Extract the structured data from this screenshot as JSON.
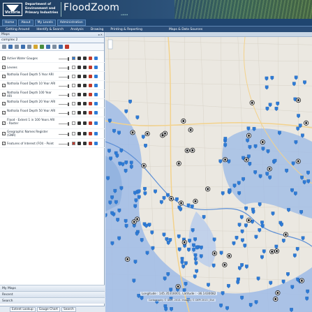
{
  "header": {
    "logo_text": "Victoria",
    "department": "Department of Environment and Primary Industries",
    "app_title": "FloodZoom",
    "version": "v.4.0.0"
  },
  "nav_links": [
    "Home",
    "About",
    "My Levels",
    "Administration"
  ],
  "menu": [
    "Getting Around",
    "Identify & Search",
    "Analysis",
    "Drawing",
    "Printing & Reporting",
    "Maps & Data Sources"
  ],
  "panel": {
    "title": "Maps",
    "subtitle": "complex 2",
    "layers": [
      {
        "label": "Active Water Gauges",
        "checked": true
      },
      {
        "label": "Levees",
        "checked": true
      },
      {
        "label": "Nathalia Flood Depth 5 Year ARI",
        "checked": true
      },
      {
        "label": "Nathalia Flood Depth 10 Year ARI",
        "checked": true
      },
      {
        "label": "Nathalia Flood Depth 100 Year ARI",
        "checked": true
      },
      {
        "label": "Nathalia Flood Depth 20 Year ARI",
        "checked": true
      },
      {
        "label": "Nathalia Flood Depth 50 Year ARI",
        "checked": true
      },
      {
        "label": "Flood - Extent 1 in 100 Years ARI - Raster",
        "checked": true
      },
      {
        "label": "Geographic Names Register (GNR)",
        "checked": true
      },
      {
        "label": "Features of Interest (FOI) - Point",
        "checked": true
      }
    ],
    "sections": [
      "My Maps",
      "Recent",
      "Search"
    ],
    "bottom_tabs": [
      "Extent Lookup",
      "Gauge Chart",
      "Search"
    ]
  },
  "map": {
    "coordinates_text": "Longitude : 145.35316001, Latitude : -36.1430082",
    "attribution": "Cartography © DEPI, 2013. Imagery © DEPI 2013 | Esri"
  },
  "colors": {
    "header_bg": "#1d3b5e",
    "menu_bg": "#2a4d78",
    "flood_extent": "#9fbbe6",
    "gauge_marker": "#2e7bd6",
    "foi_marker": "#1d1d1d",
    "road": "#f3d28c"
  }
}
